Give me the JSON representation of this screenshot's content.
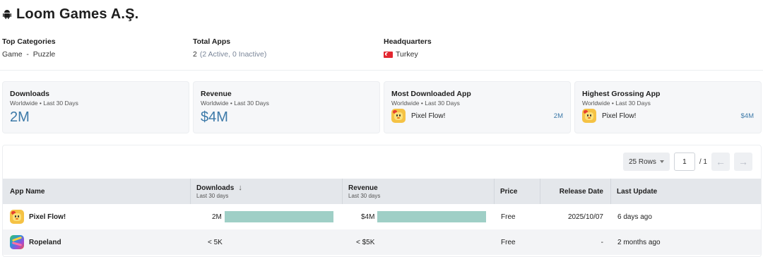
{
  "company": {
    "name": "Loom Games A.Ş.",
    "platform_icon": "android-icon"
  },
  "meta": {
    "top_categories": {
      "label": "Top Categories",
      "value": "Game  -  Puzzle"
    },
    "total_apps": {
      "label": "Total Apps",
      "value": "2",
      "detail": "(2 Active, 0 Inactive)"
    },
    "headquarters": {
      "label": "Headquarters",
      "value": "Turkey",
      "flag_icon": "turkey-flag-icon"
    }
  },
  "cards": {
    "downloads": {
      "title": "Downloads",
      "subtitle": "Worldwide • Last 30 Days",
      "value": "2M"
    },
    "revenue": {
      "title": "Revenue",
      "subtitle": "Worldwide • Last 30 Days",
      "value": "$4M"
    },
    "most_downloaded": {
      "title": "Most Downloaded App",
      "subtitle": "Worldwide • Last 30 Days",
      "app": "Pixel Flow!",
      "value": "2M"
    },
    "highest_grossing": {
      "title": "Highest Grossing App",
      "subtitle": "Worldwide • Last 30 Days",
      "app": "Pixel Flow!",
      "value": "$4M"
    }
  },
  "pager": {
    "rows_label": "25 Rows",
    "page_value": "1",
    "total": "/ 1"
  },
  "table": {
    "columns": {
      "app_name": "App Name",
      "downloads": "Downloads",
      "downloads_sub": "Last 30 days",
      "revenue": "Revenue",
      "revenue_sub": "Last 30 days",
      "price": "Price",
      "release_date": "Release Date",
      "last_update": "Last Update"
    },
    "rows": [
      {
        "name": "Pixel Flow!",
        "downloads": "2M",
        "downloads_share": 1.0,
        "revenue": "$4M",
        "revenue_share": 1.0,
        "price": "Free",
        "release_date": "2025/10/07",
        "last_update": "6 days ago"
      },
      {
        "name": "Ropeland",
        "downloads": "< 5K",
        "downloads_share": 0,
        "revenue": "< $5K",
        "revenue_share": 0,
        "price": "Free",
        "release_date": "-",
        "last_update": "2 months ago"
      }
    ]
  },
  "colors": {
    "accent": "#3c79a8",
    "bar": "#9fcfc6",
    "header_bg": "#e4e7eb",
    "card_bg": "#f6f7f9"
  }
}
